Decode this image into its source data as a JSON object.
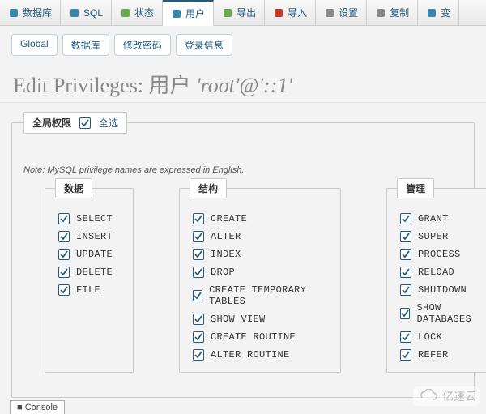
{
  "topTabs": [
    {
      "label": "数据库",
      "icon": "database-icon",
      "color": "#3a87ad"
    },
    {
      "label": "SQL",
      "icon": "sql-icon",
      "color": "#3a87ad"
    },
    {
      "label": "状态",
      "icon": "status-icon",
      "color": "#6aa84f"
    },
    {
      "label": "用户",
      "icon": "users-icon",
      "color": "#3a87ad",
      "active": true
    },
    {
      "label": "导出",
      "icon": "export-icon",
      "color": "#6aa84f"
    },
    {
      "label": "导入",
      "icon": "import-icon",
      "color": "#c0392b"
    },
    {
      "label": "设置",
      "icon": "settings-icon",
      "color": "#888"
    },
    {
      "label": "复制",
      "icon": "replication-icon",
      "color": "#888"
    },
    {
      "label": "变量",
      "icon": "variables-icon",
      "color": "#3a87ad",
      "truncated": "变"
    }
  ],
  "subTabs": [
    "Global",
    "数据库",
    "修改密码",
    "登录信息"
  ],
  "heading": {
    "prefix": "Edit Privileges: ",
    "userLabel": "用户",
    "quoted": "'root'@'::1'"
  },
  "globalLegend": {
    "title": "全局权限",
    "checkAll": "全选",
    "checked": true
  },
  "note": "Note: MySQL privilege names are expressed in English.",
  "groups": {
    "data": {
      "title": "数据",
      "items": [
        "SELECT",
        "INSERT",
        "UPDATE",
        "DELETE",
        "FILE"
      ]
    },
    "structure": {
      "title": "结构",
      "items": [
        "CREATE",
        "ALTER",
        "INDEX",
        "DROP",
        "CREATE TEMPORARY TABLES",
        "SHOW VIEW",
        "CREATE ROUTINE",
        "ALTER ROUTINE"
      ]
    },
    "admin": {
      "title": "管理",
      "items": [
        "GRANT",
        "SUPER",
        "PROCESS",
        "RELOAD",
        "SHUTDOWN",
        "SHOW DATABASES",
        "LOCK",
        "REFER"
      ]
    }
  },
  "console": "Console",
  "watermark": "亿速云"
}
